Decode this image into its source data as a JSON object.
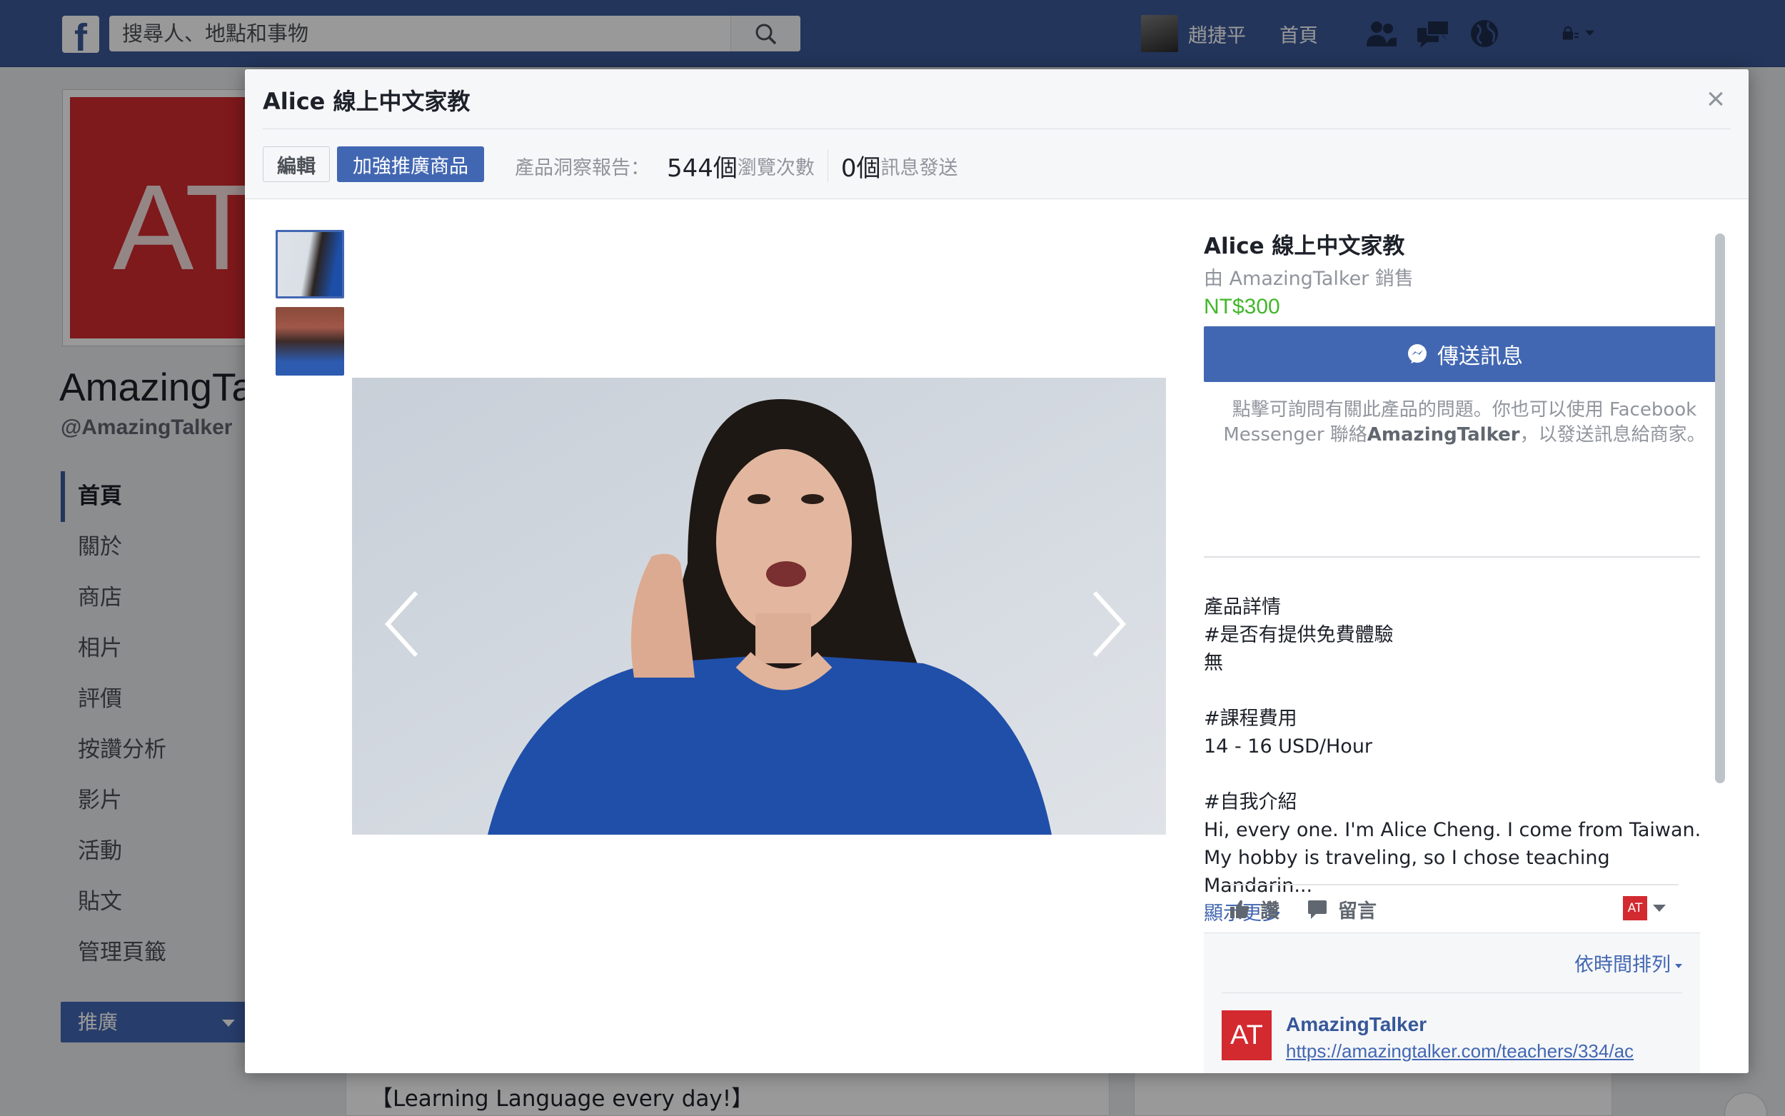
{
  "topbar": {
    "search_placeholder": "搜尋人、地點和事物",
    "user_name": "趙捷平",
    "home_label": "首頁"
  },
  "page": {
    "cover_text": "AT",
    "name": "AmazingTal",
    "handle": "@AmazingTalker",
    "nav": [
      "首頁",
      "關於",
      "商店",
      "相片",
      "評價",
      "按讚分析",
      "影片",
      "活動",
      "貼文",
      "管理頁籤"
    ],
    "promote_label": "推廣",
    "post_text": "【Learning Language every day!】"
  },
  "modal": {
    "title": "Alice 線上中文家教",
    "close_label": "×",
    "edit_label": "編輯",
    "boost_label": "加強推廣商品",
    "insights_label": "產品洞察報告：",
    "views_count": "544個",
    "views_label": "瀏覽次數",
    "messages_count": "0個",
    "messages_label": "訊息發送"
  },
  "product": {
    "title": "Alice 線上中文家教",
    "seller": "由 AmazingTalker 銷售",
    "price": "NT$300",
    "message_button": "傳送訊息",
    "note_prefix": "點擊可詢問有關此產品的問題。你也可以使用 Facebook Messenger 聯絡",
    "note_brand": "AmazingTalker",
    "note_suffix": "，以發送訊息給商家。",
    "details_heading": "產品詳情",
    "free_trial_q": "#是否有提供免費體驗",
    "free_trial_a": "無",
    "fee_q": "#課程費用",
    "fee_a": "14 - 16 USD/Hour",
    "intro_q": "#自我介紹",
    "intro_a": "Hi, every one. I'm Alice Cheng. I come from Taiwan. My hobby is traveling, so I chose teaching Mandarin...",
    "show_more": "顯示更多"
  },
  "actions": {
    "like_label": "讚",
    "comment_label": "留言",
    "avatar_text": "AT"
  },
  "comments": {
    "sort_label": "依時間排列",
    "items": [
      {
        "avatar": "AT",
        "name": "AmazingTalker",
        "link": "https://amazingtalker.com/teachers/334/ac"
      }
    ]
  },
  "colors": {
    "brand_blue": "#3b5998",
    "button_blue": "#4267b2",
    "price_green": "#42b72a",
    "cover_red": "#d32a2f"
  }
}
